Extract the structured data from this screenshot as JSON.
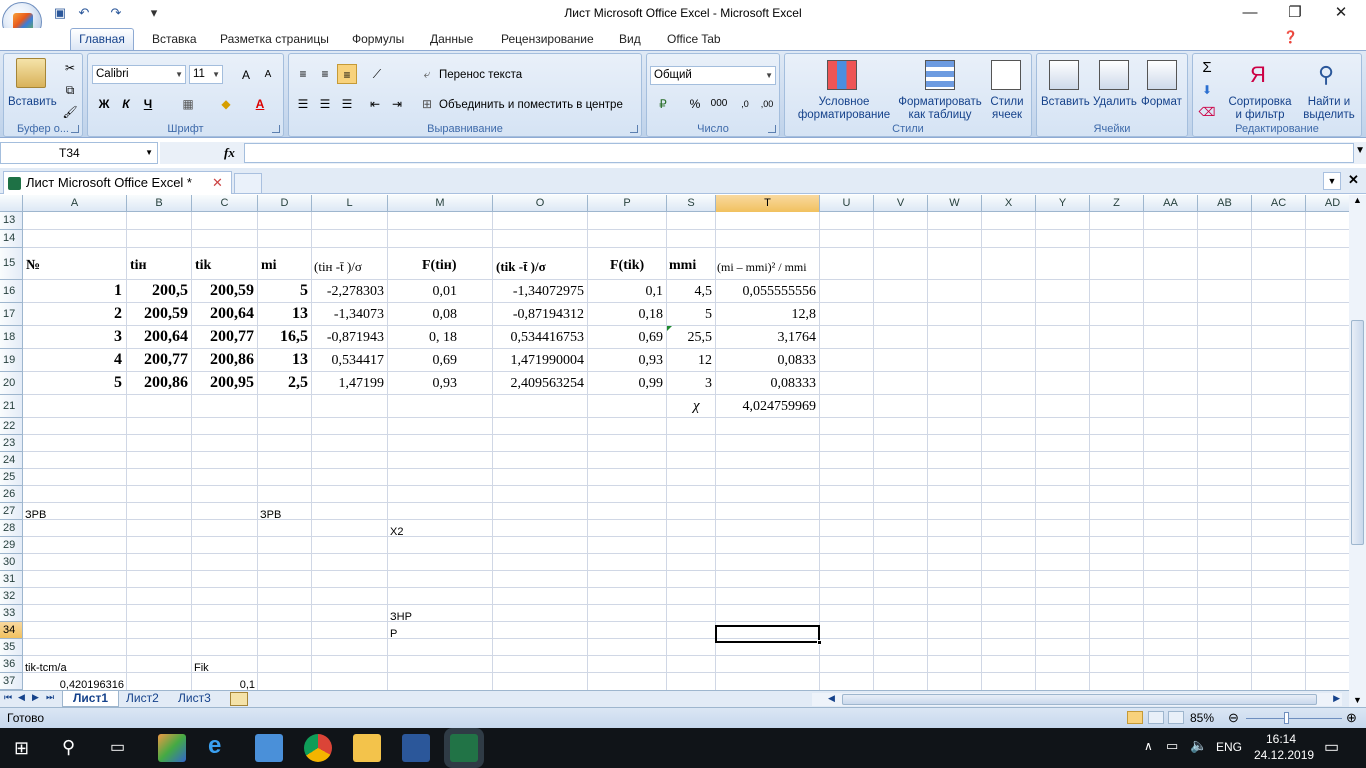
{
  "window": {
    "title": "Лист Microsoft Office Excel - Microsoft Excel",
    "minimize": "—",
    "restore": "❐",
    "close": "✕"
  },
  "ribbon_tabs": [
    "Главная",
    "Вставка",
    "Разметка страницы",
    "Формулы",
    "Данные",
    "Рецензирование",
    "Вид",
    "Office Tab"
  ],
  "ribbon": {
    "clipboard": {
      "paste": "Вставить",
      "label": "Буфер о..."
    },
    "font": {
      "name": "Calibri",
      "size": "11",
      "bold": "Ж",
      "italic": "К",
      "underline": "Ч",
      "label": "Шрифт",
      "grow": "A",
      "shrink": "A"
    },
    "alignment": {
      "wrap": "Перенос текста",
      "merge": "Объединить и поместить в центре",
      "label": "Выравнивание"
    },
    "number": {
      "format": "Общий",
      "percent": "%",
      "thousands": "000",
      "label": "Число"
    },
    "styles": {
      "conditional": "Условное форматирование",
      "format_table": "Форматировать как таблицу",
      "cell_styles": "Стили ячеек",
      "label": "Стили"
    },
    "cells": {
      "insert": "Вставить",
      "delete": "Удалить",
      "format": "Формат",
      "label": "Ячейки"
    },
    "editing": {
      "sort": "Сортировка и фильтр",
      "find": "Найти и выделить",
      "label": "Редактирование"
    }
  },
  "formula_bar": {
    "name_box": "T34",
    "fx": "fx",
    "value": ""
  },
  "doc_tab": {
    "label": "Лист Microsoft Office Excel *"
  },
  "columns": [
    "A",
    "B",
    "C",
    "D",
    "L",
    "M",
    "O",
    "P",
    "S",
    "T",
    "U",
    "V",
    "W",
    "X",
    "Y",
    "Z",
    "AA",
    "AB",
    "AC",
    "AD"
  ],
  "rows": [
    "13",
    "14",
    "15",
    "16",
    "17",
    "18",
    "19",
    "20",
    "21",
    "22",
    "23",
    "24",
    "25",
    "26",
    "27",
    "28",
    "29",
    "30",
    "31",
    "32",
    "33",
    "34",
    "35",
    "36",
    "37"
  ],
  "table": {
    "headers": {
      "A": "№",
      "B": "tін",
      "C": "tik",
      "D": "mі",
      "L": "(tін -t̄ )/σ",
      "M": "F(tін)",
      "O": "(tіk -t̄ )/σ",
      "P": "F(tіk)",
      "S": "mmі",
      "T": "(mі – mmі)² / mmі"
    },
    "rows": [
      {
        "A": "1",
        "B": "200,5",
        "C": "200,59",
        "D": "5",
        "L": "-2,278303",
        "M": "0,01",
        "O": "-1,34072975",
        "P": "0,1",
        "S": "4,5",
        "T": "0,055555556"
      },
      {
        "A": "2",
        "B": "200,59",
        "C": "200,64",
        "D": "13",
        "L": "-1,34073",
        "M": "0,08",
        "O": "-0,87194312",
        "P": "0,18",
        "S": "5",
        "T": "12,8"
      },
      {
        "A": "3",
        "B": "200,64",
        "C": "200,77",
        "D": "16,5",
        "L": "-0,871943",
        "M": "0, 18",
        "O": "0,534416753",
        "P": "0,69",
        "S": "25,5",
        "T": "3,1764"
      },
      {
        "A": "4",
        "B": "200,77",
        "C": "200,86",
        "D": "13",
        "L": "0,534417",
        "M": "0,69",
        "O": "1,471990004",
        "P": "0,93",
        "S": "12",
        "T": "0,0833"
      },
      {
        "A": "5",
        "B": "200,86",
        "C": "200,95",
        "D": "2,5",
        "L": "1,47199",
        "M": "0,93",
        "O": "2,409563254",
        "P": "0,99",
        "S": "3",
        "T": "0,08333"
      }
    ],
    "chi_label": "χ",
    "chi_value": "4,024759969"
  },
  "notes": {
    "a27": "ЗРВ",
    "d27": "ЗРВ",
    "m28": "X2",
    "m33": "ЗНР",
    "m34": "P",
    "a36": "tik-tcm/a",
    "c36": "Fik",
    "a37": "0,420196316",
    "c37": "0,1"
  },
  "sheets": [
    "Лист1",
    "Лист2",
    "Лист3"
  ],
  "status": {
    "ready": "Готово",
    "zoom": "85%"
  },
  "taskbar": {
    "lang": "ENG",
    "time": "16:14",
    "date": "24.12.2019"
  }
}
